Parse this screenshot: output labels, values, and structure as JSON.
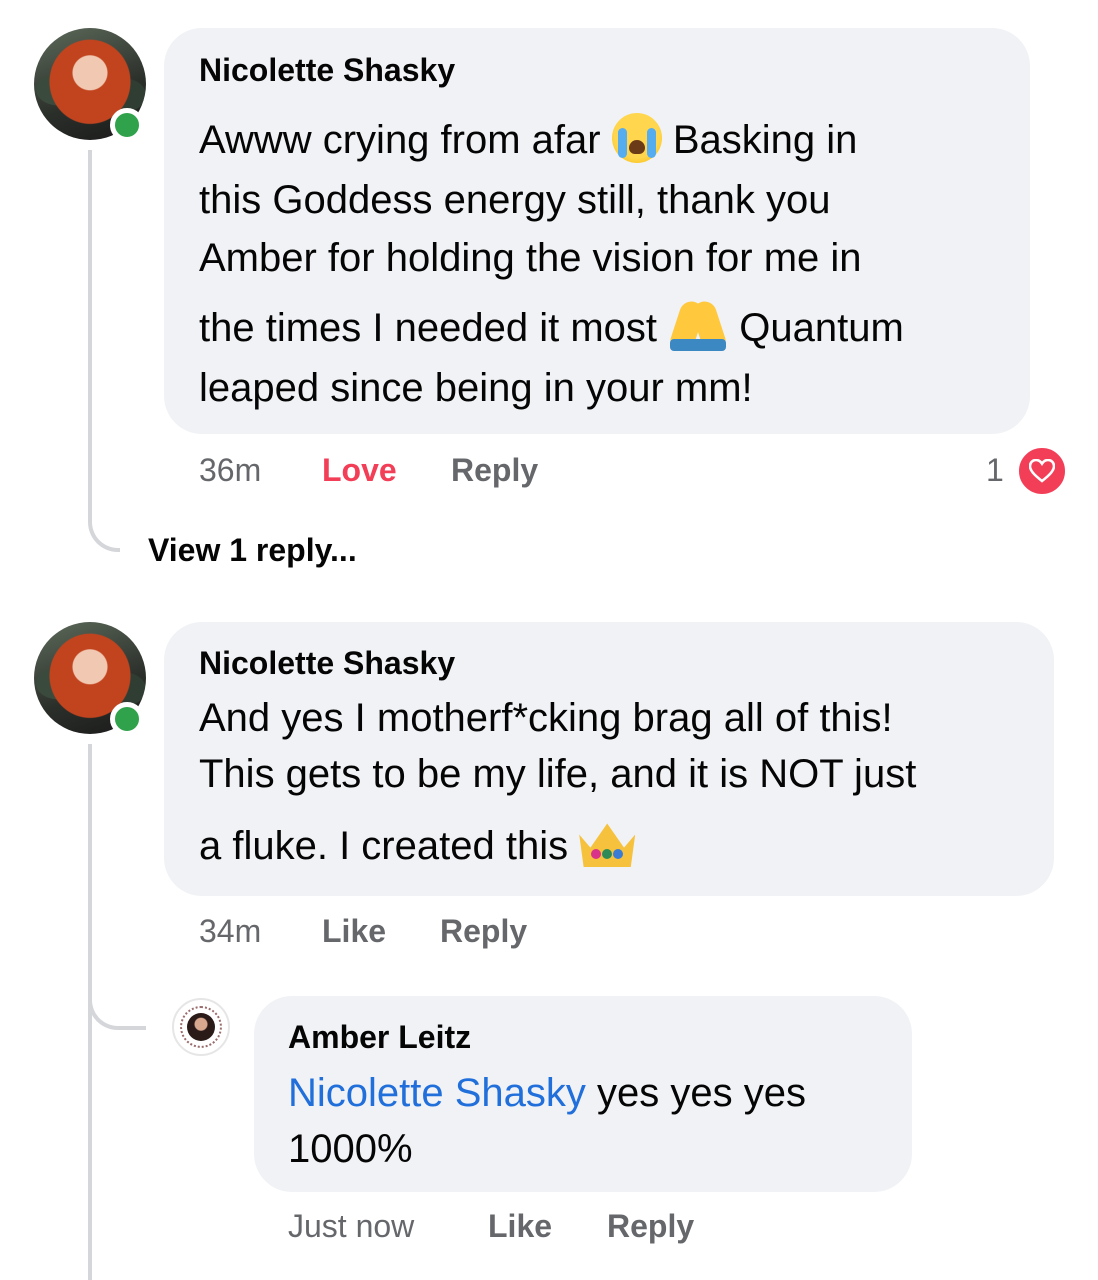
{
  "comments": [
    {
      "author": "Nicolette Shasky",
      "lines": [
        {
          "before": "Awww crying from afar ",
          "emoji": "loudly-crying-face",
          "after": " Basking in"
        },
        {
          "text": "this Goddess energy still, thank you"
        },
        {
          "text": "Amber for holding the vision for me in"
        },
        {
          "before": "the times I needed it most ",
          "emoji": "folded-hands",
          "after": " Quantum"
        },
        {
          "text": "leaped since being in your mm!"
        }
      ],
      "time": "36m",
      "reaction_label": "Love",
      "reply_label": "Reply",
      "reaction_count": "1",
      "reaction_icon": "heart-icon",
      "view_replies": "View 1 reply..."
    },
    {
      "author": "Nicolette Shasky",
      "lines": [
        {
          "text": "And yes I motherf*cking brag all of this!"
        },
        {
          "text": "This gets to be my life, and it is NOT just"
        },
        {
          "before": "a fluke. I created this ",
          "emoji": "crown"
        }
      ],
      "time": "34m",
      "like_label": "Like",
      "reply_label": "Reply",
      "replies": [
        {
          "author": "Amber Leitz",
          "mention": "Nicolette Shasky",
          "line1_after": " yes yes yes",
          "line2": "1000%",
          "time": "Just now",
          "like_label": "Like",
          "reply_label": "Reply"
        }
      ]
    }
  ],
  "colors": {
    "bubble": "#f0f2f5",
    "meta": "#65676b",
    "love": "#f33e58",
    "mention": "#216fdb",
    "online": "#31a24c"
  }
}
